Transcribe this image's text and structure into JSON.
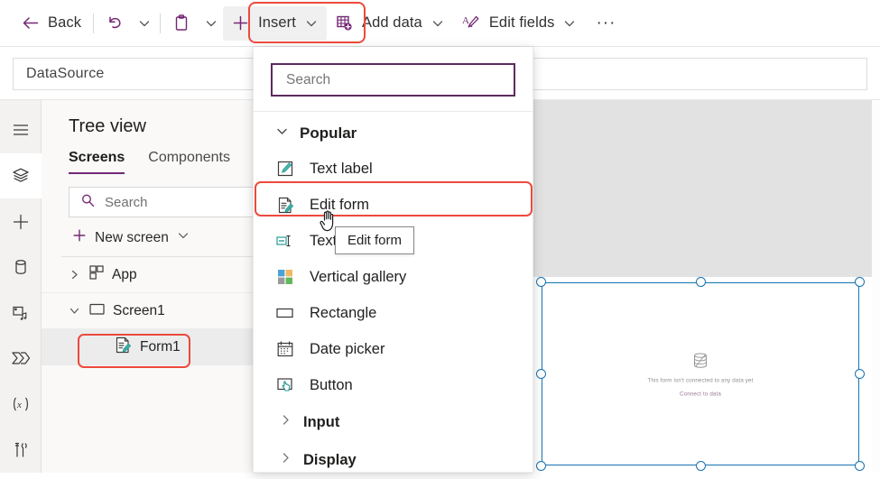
{
  "toolbar": {
    "back_label": "Back",
    "undo_icon": "undo-icon",
    "paste_icon": "paste-icon",
    "insert_label": "Insert",
    "add_data_label": "Add data",
    "edit_fields_label": "Edit fields",
    "overflow_label": "···"
  },
  "formula": {
    "datasource_value": "DataSource",
    "datasource_placeholder": "DataSource"
  },
  "rail": {
    "items": [
      {
        "name": "menu-icon",
        "label": "Menu"
      },
      {
        "name": "tree-view-icon",
        "label": "Tree view"
      },
      {
        "name": "insert-icon",
        "label": "Insert"
      },
      {
        "name": "data-icon",
        "label": "Data"
      },
      {
        "name": "media-icon",
        "label": "Media"
      },
      {
        "name": "power-automate-icon",
        "label": "Power Automate"
      },
      {
        "name": "variables-icon",
        "label": "Variables"
      },
      {
        "name": "advanced-tools-icon",
        "label": "Advanced tools"
      }
    ]
  },
  "treeview": {
    "title": "Tree view",
    "tabs": [
      {
        "label": "Screens",
        "active": true
      },
      {
        "label": "Components",
        "active": false
      }
    ],
    "search_placeholder": "Search",
    "new_screen_label": "New screen",
    "rows": [
      {
        "label": "App",
        "twisty": "collapsed",
        "icon": "app-icon",
        "indent": 0
      },
      {
        "label": "Screen1",
        "twisty": "expanded",
        "icon": "screen-icon",
        "indent": 0
      },
      {
        "label": "Form1",
        "twisty": "none",
        "icon": "edit-form-icon",
        "indent": 1,
        "selected": true
      }
    ]
  },
  "insert_panel": {
    "search_placeholder": "Search",
    "groups": [
      {
        "label": "Popular",
        "expanded": true,
        "items": [
          {
            "label": "Text label",
            "icon": "text-label-icon"
          },
          {
            "label": "Edit form",
            "icon": "edit-form-icon",
            "highlighted": true
          },
          {
            "label": "Text input",
            "icon": "text-input-icon"
          },
          {
            "label": "Vertical gallery",
            "icon": "vertical-gallery-icon"
          },
          {
            "label": "Rectangle",
            "icon": "rectangle-icon"
          },
          {
            "label": "Date picker",
            "icon": "date-picker-icon"
          },
          {
            "label": "Button",
            "icon": "button-icon"
          }
        ]
      },
      {
        "label": "Input",
        "expanded": false,
        "items": []
      },
      {
        "label": "Display",
        "expanded": false,
        "items": []
      }
    ]
  },
  "tooltip": {
    "text": "Edit form"
  },
  "canvas": {
    "form_message": "This form isn't connected to any data yet",
    "form_link": "Connect to data",
    "form_icon": "data-table-icon"
  },
  "colors": {
    "accent_purple": "#742774",
    "focus_purple": "#5c2a5c",
    "annotation_red": "#ec4a3c",
    "selection_blue": "#1673b1",
    "canvas_gray": "#e2e2e2",
    "panel_gray": "#f3f2f1"
  }
}
